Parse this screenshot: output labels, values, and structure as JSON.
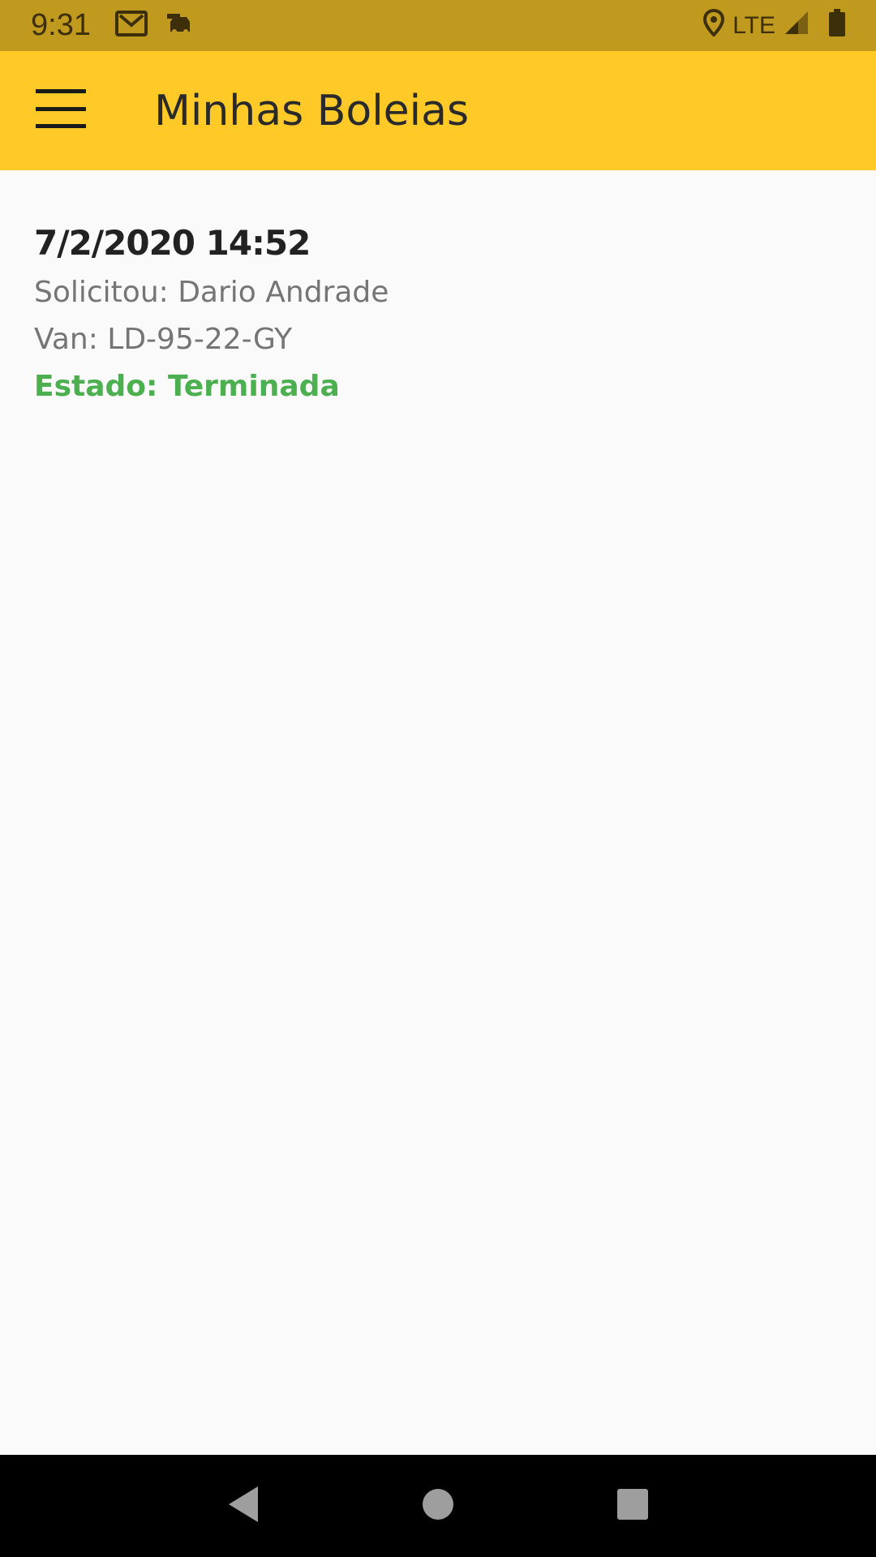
{
  "status_bar": {
    "time": "9:31",
    "network": "LTE",
    "icons": [
      "gmail-icon",
      "car-icon",
      "location-icon",
      "signal-icon",
      "battery-icon"
    ]
  },
  "app_bar": {
    "title": "Minhas Boleias",
    "menu_icon": "hamburger-menu-icon"
  },
  "rides": [
    {
      "datetime": "7/2/2020 14:52",
      "requested_by": "Solicitou: Dario Andrade",
      "van": "Van: LD-95-22-GY",
      "status": "Estado: Terminada",
      "status_color": "#4CAF50"
    }
  ],
  "colors": {
    "status_bar": "#C09A1F",
    "app_bar": "#FFCA28",
    "background": "#FAFAFA",
    "status_ok": "#4CAF50"
  },
  "nav": {
    "icons": [
      "back-icon",
      "home-icon",
      "recents-icon"
    ]
  }
}
